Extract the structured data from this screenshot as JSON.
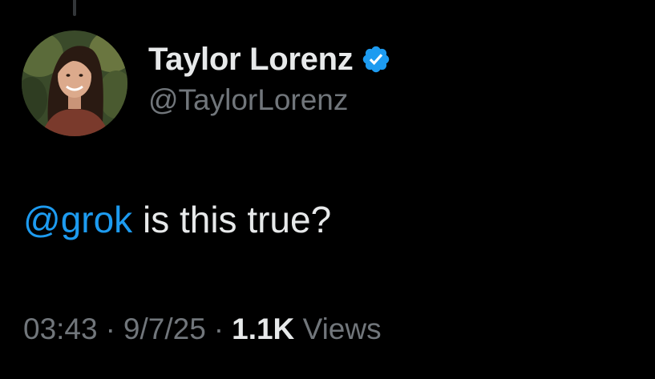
{
  "author": {
    "display_name": "Taylor Lorenz",
    "handle": "@TaylorLorenz",
    "verified_icon": "verified-badge-icon",
    "avatar_icon": "profile-photo"
  },
  "tweet": {
    "mention": "@grok",
    "text": " is this true?"
  },
  "meta": {
    "time": "03:43",
    "separator": "·",
    "date": "9/7/25",
    "views_count": "1.1K",
    "views_label": "Views"
  },
  "colors": {
    "background": "#000000",
    "primary_text": "#e7e9ea",
    "secondary_text": "#71767b",
    "accent": "#1d9bf0"
  }
}
